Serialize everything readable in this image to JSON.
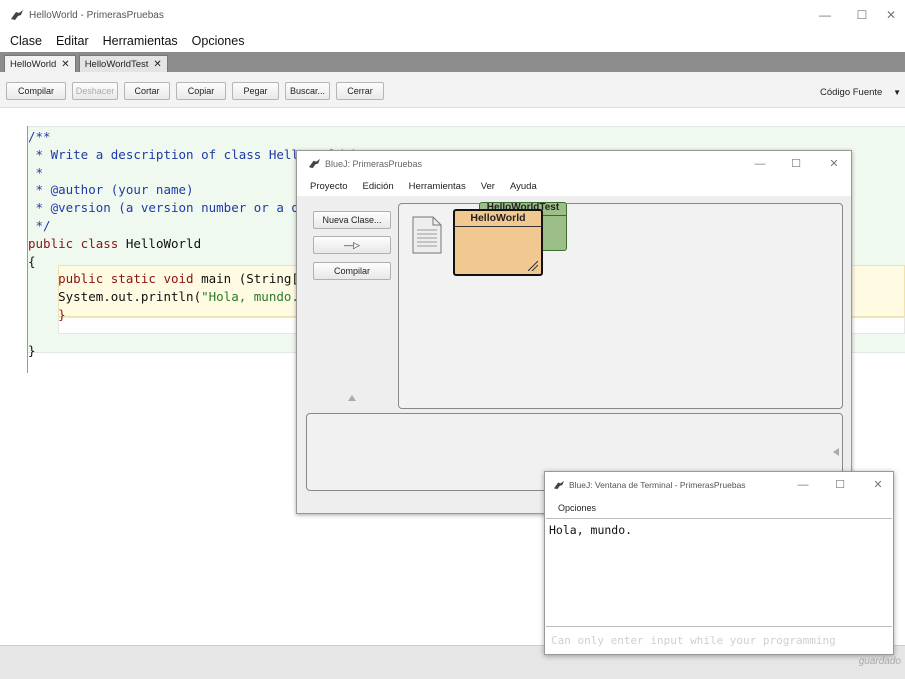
{
  "main_window": {
    "title": "HelloWorld - PrimerasPruebas",
    "controls": {
      "minimize": "—",
      "maximize": "☐",
      "close": "✕"
    }
  },
  "menu": [
    "Clase",
    "Editar",
    "Herramientas",
    "Opciones"
  ],
  "tabs": [
    {
      "label": "HelloWorld",
      "close": "✕"
    },
    {
      "label": "HelloWorldTest",
      "close": "✕"
    }
  ],
  "toolbar": {
    "compile": "Compilar",
    "undo": "Deshacer",
    "cut": "Cortar",
    "copy": "Copiar",
    "paste": "Pegar",
    "find": "Buscar...",
    "close": "Cerrar",
    "view_select": "Código Fuente",
    "view_select_arrow": "▼"
  },
  "code": {
    "l1": "/**",
    "l2": " * Write a description of class HelloWorld here",
    "l3": " *",
    "l4": " * @author (your name)",
    "l5": " * @version (a version number or a date)",
    "l6": " */",
    "l7_kw": "public class",
    "l7_name": " HelloWorld",
    "l8": "{",
    "l9_kw": "    public static void",
    "l9_rest": " main (String[] args)",
    "l10_a": "    System.out.println(",
    "l10_str": "\"Hola, mundo.\"",
    "l10_b": ");",
    "l11": "    }",
    "l12": "}"
  },
  "status": {
    "saved": "guardado"
  },
  "bluej": {
    "title": "BlueJ: PrimerasPruebas",
    "controls": {
      "minimize": "—",
      "maximize": "☐",
      "close": "✕"
    },
    "menu": [
      "Proyecto",
      "Edición",
      "Herramientas",
      "Ver",
      "Ayuda"
    ],
    "buttons": {
      "new_class": "Nueva Clase...",
      "arrow": "—▷",
      "compile": "Compilar"
    },
    "classes": {
      "test": "HelloWorldTest",
      "main": "HelloWorld"
    }
  },
  "terminal": {
    "title": "BlueJ: Ventana de Terminal - PrimerasPruebas",
    "controls": {
      "minimize": "—",
      "maximize": "☐",
      "close": "✕"
    },
    "menu": "Opciones",
    "output": "Hola, mundo.",
    "input_hint": "Can only enter input while your programming"
  }
}
